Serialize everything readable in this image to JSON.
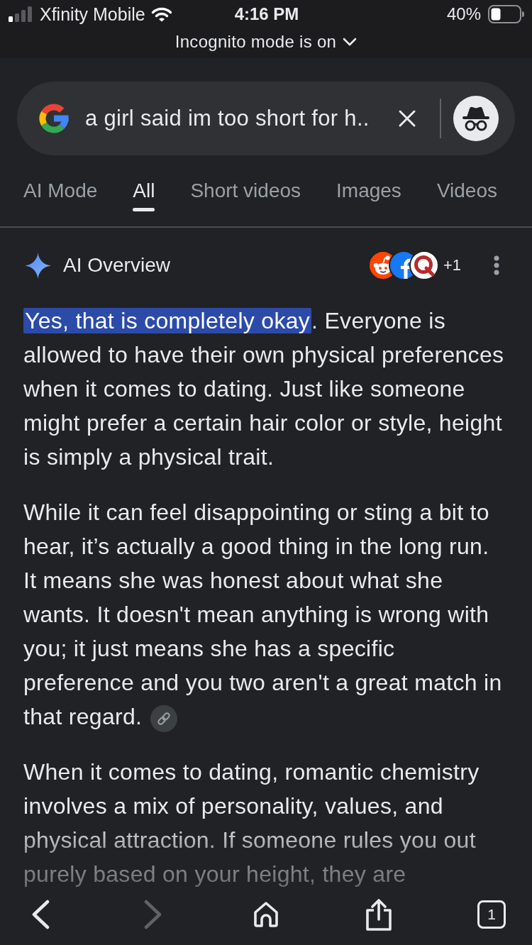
{
  "status_bar": {
    "carrier": "Xfinity Mobile",
    "time": "4:16 PM",
    "battery": "40%"
  },
  "incognito_banner": {
    "text": "Incognito mode is on"
  },
  "search": {
    "value": "a girl said im too short for h.."
  },
  "tabs": [
    {
      "label": "AI Mode",
      "selected": false
    },
    {
      "label": "All",
      "selected": true
    },
    {
      "label": "Short videos",
      "selected": false
    },
    {
      "label": "Images",
      "selected": false
    },
    {
      "label": "Videos",
      "selected": false
    }
  ],
  "ai_overview": {
    "title": "AI Overview",
    "more_sources": "+1",
    "paragraphs": [
      {
        "highlight": "Yes, that is completely okay",
        "text": ". Everyone is allowed to have their own physical preferences when it comes to dating. Just like someone might prefer a certain hair color or style, height is simply a physical trait."
      },
      {
        "text": "While it can feel disappointing or sting a bit to hear, it’s actually a good thing in the long run. It means she was honest about what she wants. It doesn't mean anything is wrong with you; it just means she has a specific preference and you two aren't a great match in that regard.",
        "link": true
      },
      {
        "text": "When it comes to dating, romantic chemistry involves a mix of personality, values, and physical attraction. If someone rules you out purely based on your height, they are"
      }
    ]
  },
  "toolbar": [
    {
      "kind": "back",
      "disabled": false
    },
    {
      "kind": "forward",
      "disabled": true
    },
    {
      "kind": "home",
      "disabled": false
    },
    {
      "kind": "share",
      "disabled": false
    },
    {
      "kind": "tabs",
      "disabled": false,
      "count": "1"
    }
  ]
}
